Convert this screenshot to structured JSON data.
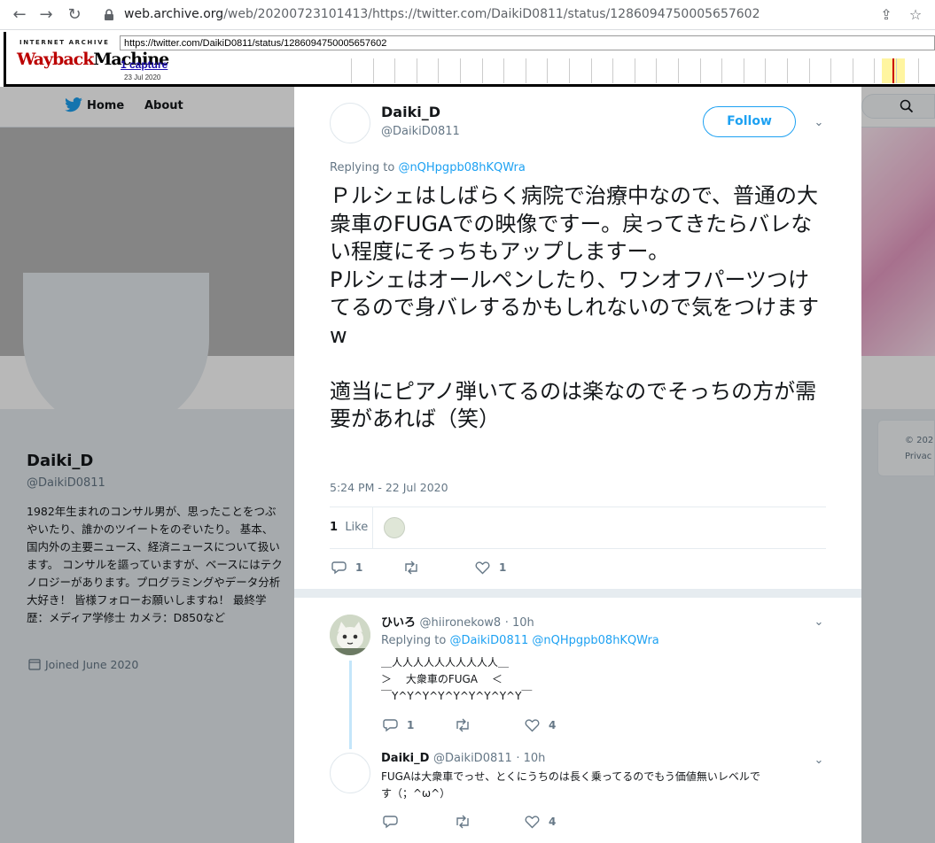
{
  "browser": {
    "url_host": "web.archive.org",
    "url_path": "/web/20200723101413/https://twitter.com/DaikiD0811/status/1286094750005657602"
  },
  "wayback": {
    "logo_top": "INTERNET ARCHIVE",
    "logo_wayback": "Wayback",
    "logo_machine": "Machine",
    "url_value": "https://twitter.com/DaikiD0811/status/1286094750005657602",
    "captures": "1 capture",
    "capture_date": "23 Jul 2020"
  },
  "background": {
    "nav": {
      "home": "Home",
      "about": "About"
    },
    "profile": {
      "name": "Daiki_D",
      "handle": "@DaikiD0811",
      "bio": "1982年生まれのコンサル男が、思ったことをつぶやいたり、誰かのツイートをのぞいたり。 基本、国内外の主要ニュース、経済ニュースについて扱います。 コンサルを謳っていますが、ベースにはテクノロジーがあります。プログラミングやデータ分析大好き！ 皆様フォローお願いしますね！ 最終学歴：メディア学修士 カメラ：D850など",
      "joined": "Joined June 2020"
    },
    "sidebar_footer": "© 202\nPrivac"
  },
  "tweet": {
    "name": "Daiki_D",
    "handle": "@DaikiD0811",
    "follow_label": "Follow",
    "replying_prefix": "Replying to",
    "replying_to": "@nQHpgpb08hKQWra",
    "text": "Ｐルシェはしばらく病院で治療中なので、普通の大衆車のFUGAでの映像ですー。戻ってきたらバレない程度にそっちもアップしますー。\nPルシェはオールペンしたり、ワンオフパーツつけてるので身バレするかもしれないので気をつけますw\n\n適当にピアノ弾いてるのは楽なのでそっちの方が需要があれば（笑）",
    "timestamp": "5:24 PM - 22 Jul 2020",
    "likes_count": "1",
    "likes_label": "Like",
    "actions": {
      "replies": "1",
      "retweets": "",
      "likes": "1"
    }
  },
  "replies": [
    {
      "name": "ひいろ",
      "handle": "@hiironekow8",
      "time": "· 10h",
      "replying_prefix": "Replying to",
      "replying_to": "@DaikiD0811 @nQHpgpb08hKQWra",
      "text": "＿人人人人人人人人人人＿\n＞　 大衆車のFUGA　 ＜\n￣Y^Y^Y^Y^Y^Y^Y^Y^Y￣",
      "actions": {
        "replies": "1",
        "retweets": "",
        "likes": "4"
      }
    },
    {
      "name": "Daiki_D",
      "handle": "@DaikiD0811",
      "time": "· 10h",
      "text": "FUGAは大衆車でっせ、とくにうちのは長く乗ってるのでもう価値無いレベルで\nす（；^ω^）",
      "actions": {
        "replies": "",
        "retweets": "",
        "likes": "4"
      }
    }
  ],
  "colors": {
    "accent": "#1da1f2",
    "muted": "#657786",
    "wayback_red": "#bb0000"
  }
}
